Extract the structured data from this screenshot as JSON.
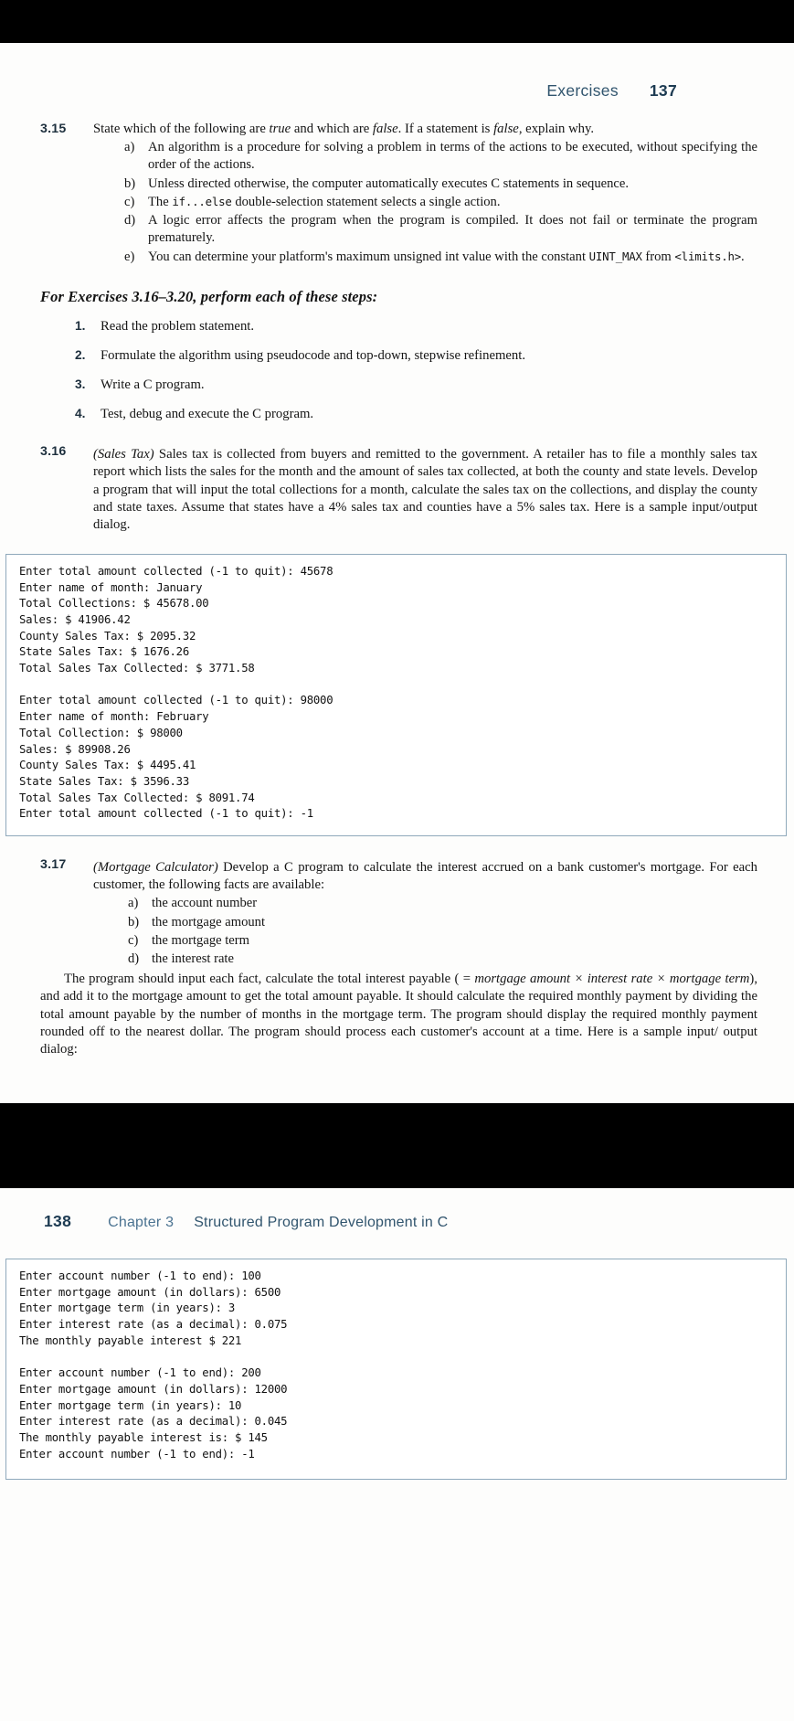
{
  "page_137": {
    "running_head": {
      "label": "Exercises",
      "number": "137"
    },
    "exercise_3_15": {
      "number": "3.15",
      "lead_pre": "State which of the following are ",
      "lead_true": "true",
      "lead_mid": " and which are ",
      "lead_false": "false",
      "lead_mid2": ". If a statement is ",
      "lead_false2": "false",
      "lead_end": ", explain why.",
      "items": [
        {
          "marker": "a)",
          "text": "An algorithm is a procedure for solving a problem in terms of the actions to be executed, without specifying the order of the actions."
        },
        {
          "marker": "b)",
          "text": "Unless directed otherwise, the computer automatically executes C statements in sequence."
        },
        {
          "marker": "c)",
          "text_pre": "The ",
          "code1": "if...else",
          "text_post": " double-selection statement selects a single action."
        },
        {
          "marker": "d)",
          "text": "A logic error affects the program when the program is compiled. It does not fail or terminate the program prematurely."
        },
        {
          "marker": "e)",
          "text_pre": "You can determine your platform's maximum unsigned int value with the constant ",
          "code1": "UINT_MAX",
          "text_mid": " from ",
          "code2": "<limits.h>",
          "text_post": "."
        }
      ]
    },
    "steps_section": {
      "heading": "For Exercises 3.16–3.20, perform each of these steps:",
      "steps": [
        {
          "marker": "1.",
          "text": "Read the problem statement."
        },
        {
          "marker": "2.",
          "text": "Formulate the algorithm using pseudocode and top-down, stepwise refinement."
        },
        {
          "marker": "3.",
          "text": "Write a C program."
        },
        {
          "marker": "4.",
          "text": "Test, debug and execute the C program."
        }
      ]
    },
    "exercise_3_16": {
      "number": "3.16",
      "title": "(Sales Tax)",
      "body": " Sales tax is collected from buyers and remitted to the government. A retailer has to file a monthly sales tax report which lists the sales for the month and the amount of sales tax collected, at both the county and state levels. Develop a program that will input the total collections for a month, calculate the sales tax on the collections, and display the county and state taxes. Assume that states have a 4% sales tax and counties have a 5% sales tax. Here is a sample input/output dialog.",
      "console": "Enter total amount collected (-1 to quit): 45678\nEnter name of month: January\nTotal Collections: $ 45678.00\nSales: $ 41906.42\nCounty Sales Tax: $ 2095.32\nState Sales Tax: $ 1676.26\nTotal Sales Tax Collected: $ 3771.58\n\nEnter total amount collected (-1 to quit): 98000\nEnter name of month: February\nTotal Collection: $ 98000\nSales: $ 89908.26\nCounty Sales Tax: $ 4495.41\nState Sales Tax: $ 3596.33\nTotal Sales Tax Collected: $ 8091.74\nEnter total amount collected (-1 to quit): -1"
    },
    "exercise_3_17": {
      "number": "3.17",
      "title": "(Mortgage Calculator)",
      "lead": " Develop a C program to calculate the interest accrued on a bank customer's mortgage. For each customer, the following facts are available:",
      "items": [
        {
          "marker": "a)",
          "text": "the account number"
        },
        {
          "marker": "b)",
          "text": "the mortgage amount"
        },
        {
          "marker": "c)",
          "text": "the mortgage term"
        },
        {
          "marker": "d)",
          "text": "the interest rate"
        }
      ],
      "para_pre": "The program should input each fact, calculate the total interest payable ( = ",
      "para_em1": "mortgage amount × interest rate × mortgage term",
      "para_post": "), and add it to the mortgage amount to get the total amount payable. It should calculate the required monthly payment by dividing the total amount payable by the number of months in the mortgage term. The program should display the required monthly payment rounded off to the nearest dollar. The program should process each customer's account at a time. Here is a sample input/ output dialog:"
    }
  },
  "page_138": {
    "running_head": {
      "number": "138",
      "chapter": "Chapter 3",
      "title": "Structured Program Development in C"
    },
    "console": "Enter account number (-1 to end): 100\nEnter mortgage amount (in dollars): 6500\nEnter mortgage term (in years): 3\nEnter interest rate (as a decimal): 0.075\nThe monthly payable interest $ 221\n\nEnter account number (-1 to end): 200\nEnter mortgage amount (in dollars): 12000\nEnter mortgage term (in years): 10\nEnter interest rate (as a decimal): 0.045\nThe monthly payable interest is: $ 145\nEnter account number (-1 to end): -1"
  }
}
